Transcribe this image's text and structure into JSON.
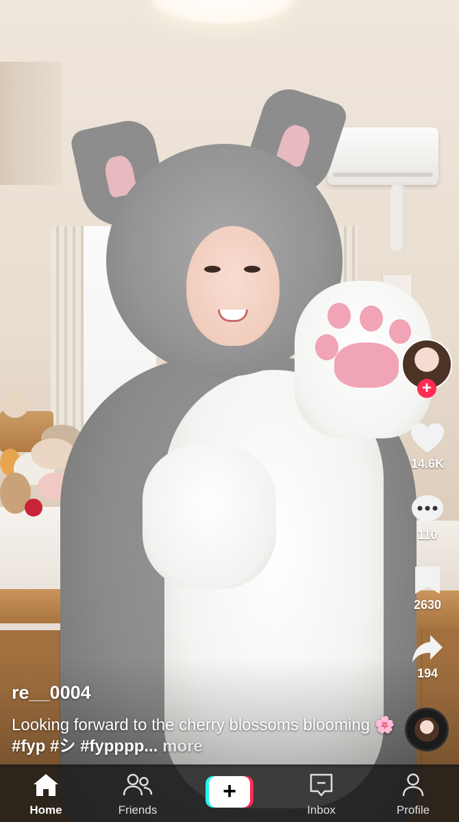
{
  "video": {
    "username": "re__0004",
    "caption_text": "Looking forward to the cherry blossoms blooming",
    "caption_emoji": "🌸",
    "hashtags": [
      "#fyp",
      "#シ",
      "#fypppp..."
    ],
    "more_label": "more"
  },
  "actions": {
    "likes": "14.6K",
    "comments": "110",
    "saves": "2630",
    "shares": "194",
    "follow_symbol": "+"
  },
  "nav": {
    "home": "Home",
    "friends": "Friends",
    "create_symbol": "+",
    "inbox": "Inbox",
    "profile": "Profile",
    "active": "home"
  },
  "colors": {
    "accent_red": "#fe2c55",
    "accent_cyan": "#25f4ee"
  },
  "icons": [
    "like-heart-icon",
    "comment-bubble-icon",
    "bookmark-icon",
    "share-arrow-icon",
    "home-icon",
    "friends-icon",
    "inbox-icon",
    "profile-icon"
  ]
}
